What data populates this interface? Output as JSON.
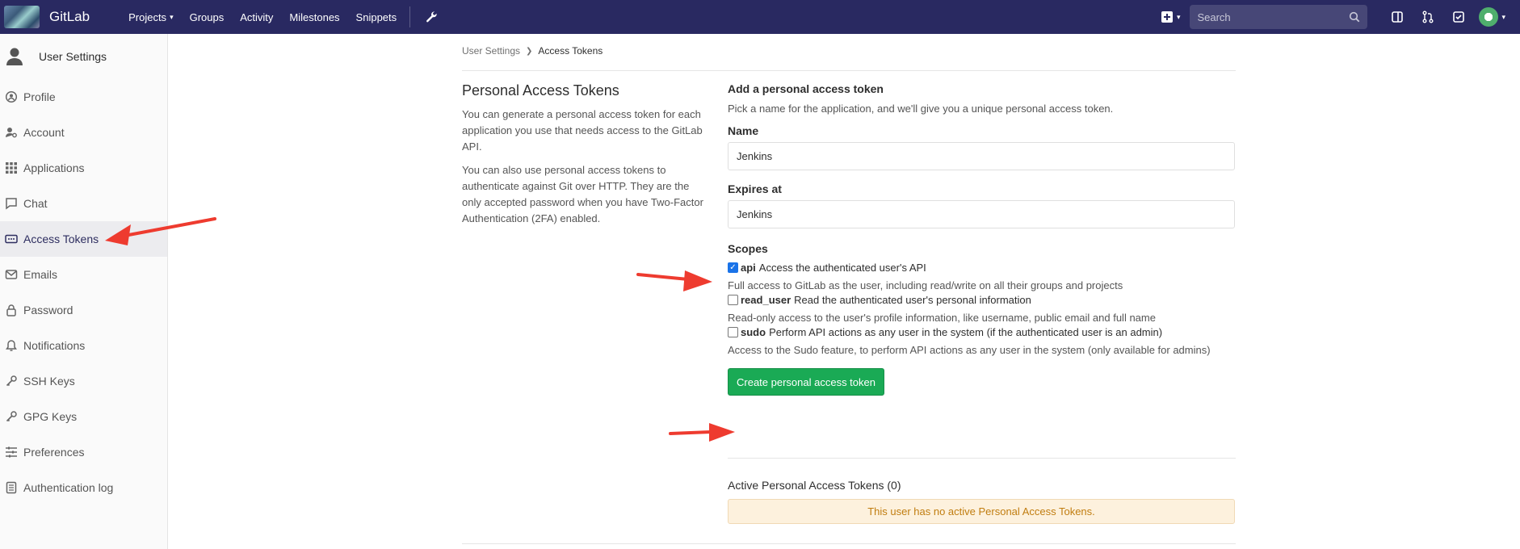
{
  "nav": {
    "brand": "GitLab",
    "links": [
      {
        "label": "Projects",
        "has_caret": true
      },
      {
        "label": "Groups"
      },
      {
        "label": "Activity"
      },
      {
        "label": "Milestones"
      },
      {
        "label": "Snippets"
      }
    ],
    "search_placeholder": "Search"
  },
  "sidebar": {
    "header": "User Settings",
    "items": [
      {
        "label": "Profile",
        "icon": "profile-icon"
      },
      {
        "label": "Account",
        "icon": "account-icon"
      },
      {
        "label": "Applications",
        "icon": "applications-icon"
      },
      {
        "label": "Chat",
        "icon": "chat-icon"
      },
      {
        "label": "Access Tokens",
        "icon": "access-tokens-icon",
        "active": true
      },
      {
        "label": "Emails",
        "icon": "email-icon"
      },
      {
        "label": "Password",
        "icon": "lock-icon"
      },
      {
        "label": "Notifications",
        "icon": "bell-icon"
      },
      {
        "label": "SSH Keys",
        "icon": "key-icon"
      },
      {
        "label": "GPG Keys",
        "icon": "key-icon"
      },
      {
        "label": "Preferences",
        "icon": "preferences-icon"
      },
      {
        "label": "Authentication log",
        "icon": "log-icon"
      }
    ]
  },
  "breadcrumb": {
    "parent": "User Settings",
    "current": "Access Tokens"
  },
  "intro": {
    "title": "Personal Access Tokens",
    "p1": "You can generate a personal access token for each application you use that needs access to the GitLab API.",
    "p2": "You can also use personal access tokens to authenticate against Git over HTTP. They are the only accepted password when you have Two-Factor Authentication (2FA) enabled."
  },
  "form": {
    "heading": "Add a personal access token",
    "subheading": "Pick a name for the application, and we'll give you a unique personal access token.",
    "name_label": "Name",
    "name_value": "Jenkins",
    "expires_label": "Expires at",
    "expires_value": "Jenkins",
    "scopes_label": "Scopes",
    "scopes": [
      {
        "key": "api",
        "desc": "Access the authenticated user's API",
        "help": "Full access to GitLab as the user, including read/write on all their groups and projects",
        "checked": true
      },
      {
        "key": "read_user",
        "desc": "Read the authenticated user's personal information",
        "help": "Read-only access to the user's profile information, like username, public email and full name",
        "checked": false
      },
      {
        "key": "sudo",
        "desc": "Perform API actions as any user in the system (if the authenticated user is an admin)",
        "help": "Access to the Sudo feature, to perform API actions as any user in the system (only available for admins)",
        "checked": false
      }
    ],
    "submit_label": "Create personal access token"
  },
  "active_tokens": {
    "heading": "Active Personal Access Tokens (0)",
    "empty_message": "This user has no active Personal Access Tokens."
  },
  "colors": {
    "nav_bg": "#292961",
    "primary_green": "#1aaa55",
    "arrow_red": "#ee3b2f",
    "notice_bg": "#fdf1dd",
    "notice_text": "#c17d10"
  }
}
